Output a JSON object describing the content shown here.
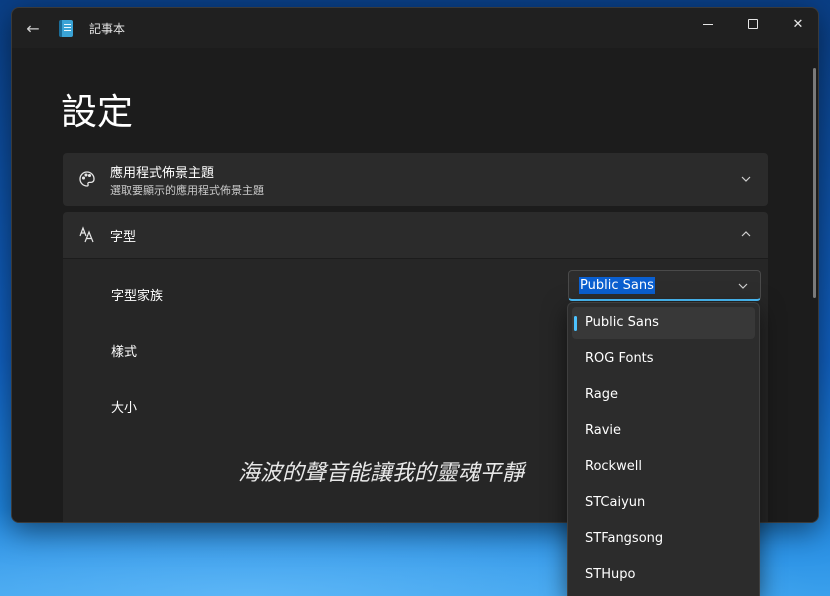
{
  "window": {
    "app_title": "記事本"
  },
  "page": {
    "title": "設定"
  },
  "theme_card": {
    "title": "應用程式佈景主題",
    "subtitle": "選取要顯示的應用程式佈景主題"
  },
  "font_card": {
    "title": "字型",
    "rows": {
      "family_label": "字型家族",
      "style_label": "樣式",
      "size_label": "大小"
    },
    "family_value": "Public Sans",
    "preview_text": "海波的聲音能讓我的靈魂平靜"
  },
  "font_dropdown": {
    "options": [
      "Public Sans",
      "ROG Fonts",
      "Rage",
      "Ravie",
      "Rockwell",
      "STCaiyun",
      "STFangsong",
      "STHupo"
    ],
    "selected_index": 0
  },
  "colors": {
    "accent": "#4cc2ff",
    "selection": "#0a5fd0"
  }
}
